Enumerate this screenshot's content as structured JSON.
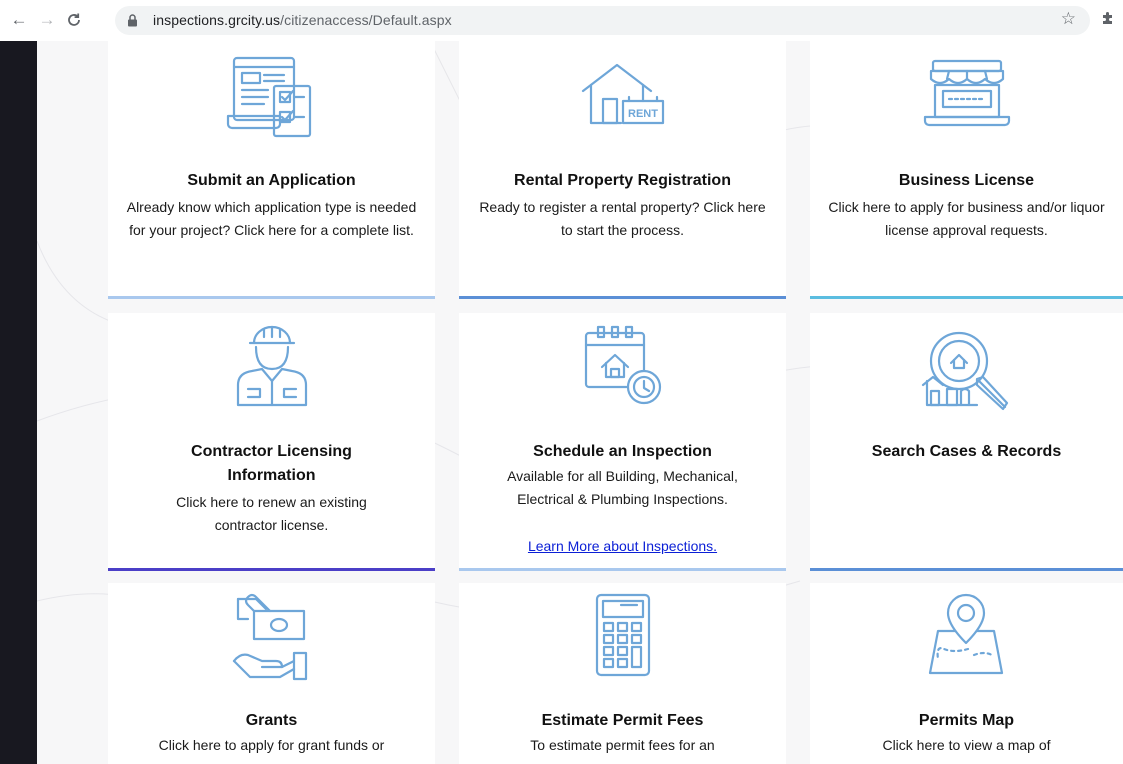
{
  "browser": {
    "url_host": "inspections.grcity.us",
    "url_path": "/citizenaccess/Default.aspx"
  },
  "cards": [
    {
      "title": "Submit an Application",
      "desc": "Already know which application type is needed for your project? Click here for a complete list.",
      "icon": "application-form-icon",
      "accent": "#a9c8ee"
    },
    {
      "title": "Rental Property Registration",
      "desc": "Ready to register a rental property? Click here to start the process.",
      "icon": "rental-house-icon",
      "accent": "#5b8fd6"
    },
    {
      "title": "Business License",
      "desc": "Click here to apply for business and/or liquor license approval requests.",
      "icon": "storefront-icon",
      "accent": "#5bbde0"
    },
    {
      "title": "Contractor Licensing Information",
      "desc": "Click here to renew an existing contractor license.",
      "icon": "contractor-worker-icon",
      "accent": "#4b3fc7"
    },
    {
      "title": "Schedule an Inspection",
      "desc": "Available for all Building, Mechanical, Electrical & Plumbing Inspections.",
      "link": "Learn More about Inspections.",
      "icon": "calendar-clock-icon",
      "accent": "#a9c8ee"
    },
    {
      "title": "Search Cases & Records",
      "desc": "",
      "icon": "search-house-icon",
      "accent": "#5b8fd6"
    },
    {
      "title": "Grants",
      "desc": "Click here to apply for grant funds or",
      "icon": "grant-money-hand-icon",
      "accent": ""
    },
    {
      "title": "Estimate Permit Fees",
      "desc": "To estimate permit fees for an",
      "icon": "calculator-icon",
      "accent": ""
    },
    {
      "title": "Permits Map",
      "desc": "Click here to view a map of",
      "icon": "map-pin-icon",
      "accent": ""
    }
  ],
  "colors": {
    "icon_stroke": "#6ea6d8",
    "link": "#0b1fd6"
  }
}
